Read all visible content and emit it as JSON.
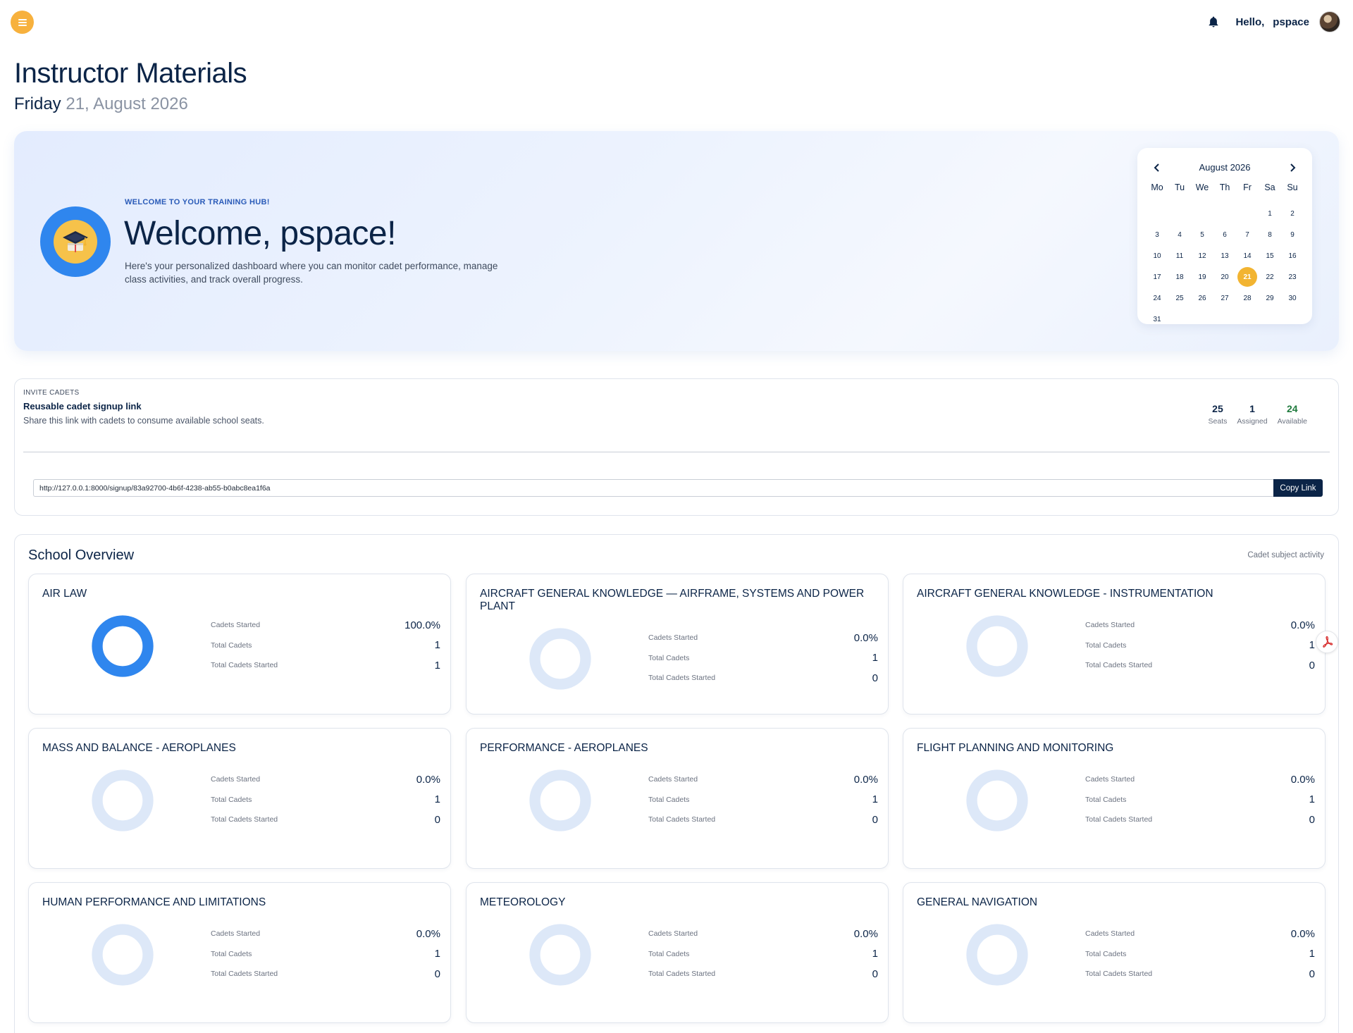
{
  "header": {
    "hello": "Hello,",
    "username": "pspace"
  },
  "page": {
    "title": "Instructor Materials",
    "weekday": "Friday",
    "date_rest": "21, August 2026"
  },
  "hero": {
    "kicker": "WELCOME TO YOUR TRAINING HUB!",
    "title": "Welcome, pspace!",
    "description": "Here's your personalized dashboard where you can monitor cadet performance, manage class activities, and track overall progress."
  },
  "calendar": {
    "month_label": "August 2026",
    "weekdays": [
      "Mo",
      "Tu",
      "We",
      "Th",
      "Fr",
      "Sa",
      "Su"
    ],
    "days": [
      "",
      "",
      "",
      "",
      "",
      "1",
      "2",
      "3",
      "4",
      "5",
      "6",
      "7",
      "8",
      "9",
      "10",
      "11",
      "12",
      "13",
      "14",
      "15",
      "16",
      "17",
      "18",
      "19",
      "20",
      "21",
      "22",
      "23",
      "24",
      "25",
      "26",
      "27",
      "28",
      "29",
      "30",
      "31"
    ],
    "selected_day": "21"
  },
  "invite": {
    "kicker": "INVITE CADETS",
    "title": "Reusable cadet signup link",
    "description": "Share this link with cadets to consume available school seats.",
    "stats": [
      {
        "value": "25",
        "label": "Seats"
      },
      {
        "value": "1",
        "label": "Assigned"
      },
      {
        "value": "24",
        "label": "Available"
      }
    ],
    "link_value": "http://127.0.0.1:8000/signup/83a92700-4b6f-4238-ab55-b0abc8ea1f6a",
    "copy_label": "Copy Link"
  },
  "overview": {
    "title": "School Overview",
    "link_label": "Cadet subject activity",
    "stat_labels": [
      "Cadets Started",
      "Total Cadets",
      "Total Cadets Started"
    ],
    "subjects": [
      {
        "title": "AIR LAW",
        "percent_text": "100.0%",
        "started_fraction": 1.0,
        "total": "1",
        "started": "1"
      },
      {
        "title": "AIRCRAFT GENERAL KNOWLEDGE — AIRFRAME, SYSTEMS AND POWER PLANT",
        "percent_text": "0.0%",
        "started_fraction": 0,
        "total": "1",
        "started": "0"
      },
      {
        "title": "AIRCRAFT GENERAL KNOWLEDGE - INSTRUMENTATION",
        "percent_text": "0.0%",
        "started_fraction": 0,
        "total": "1",
        "started": "0"
      },
      {
        "title": "MASS AND BALANCE - AEROPLANES",
        "percent_text": "0.0%",
        "started_fraction": 0,
        "total": "1",
        "started": "0"
      },
      {
        "title": "PERFORMANCE - AEROPLANES",
        "percent_text": "0.0%",
        "started_fraction": 0,
        "total": "1",
        "started": "0"
      },
      {
        "title": "FLIGHT PLANNING AND MONITORING",
        "percent_text": "0.0%",
        "started_fraction": 0,
        "total": "1",
        "started": "0"
      },
      {
        "title": "HUMAN PERFORMANCE AND LIMITATIONS",
        "percent_text": "0.0%",
        "started_fraction": 0,
        "total": "1",
        "started": "0"
      },
      {
        "title": "METEOROLOGY",
        "percent_text": "0.0%",
        "started_fraction": 0,
        "total": "1",
        "started": "0"
      },
      {
        "title": "GENERAL NAVIGATION",
        "percent_text": "0.0%",
        "started_fraction": 0,
        "total": "1",
        "started": "0"
      }
    ]
  },
  "colors": {
    "navy": "#0b2447",
    "accent_orange": "#f7b13d",
    "donut_active": "#2f86ee",
    "donut_track": "#dde8f8",
    "available_green": "#1f7a3d"
  },
  "icons": {
    "menu": "hamburger-icon",
    "notifications": "bell-icon",
    "hero": "graduation-cap-icon",
    "calendar_prev": "chevron-left-icon",
    "calendar_next": "chevron-right-icon",
    "floating": "pdf-icon"
  }
}
